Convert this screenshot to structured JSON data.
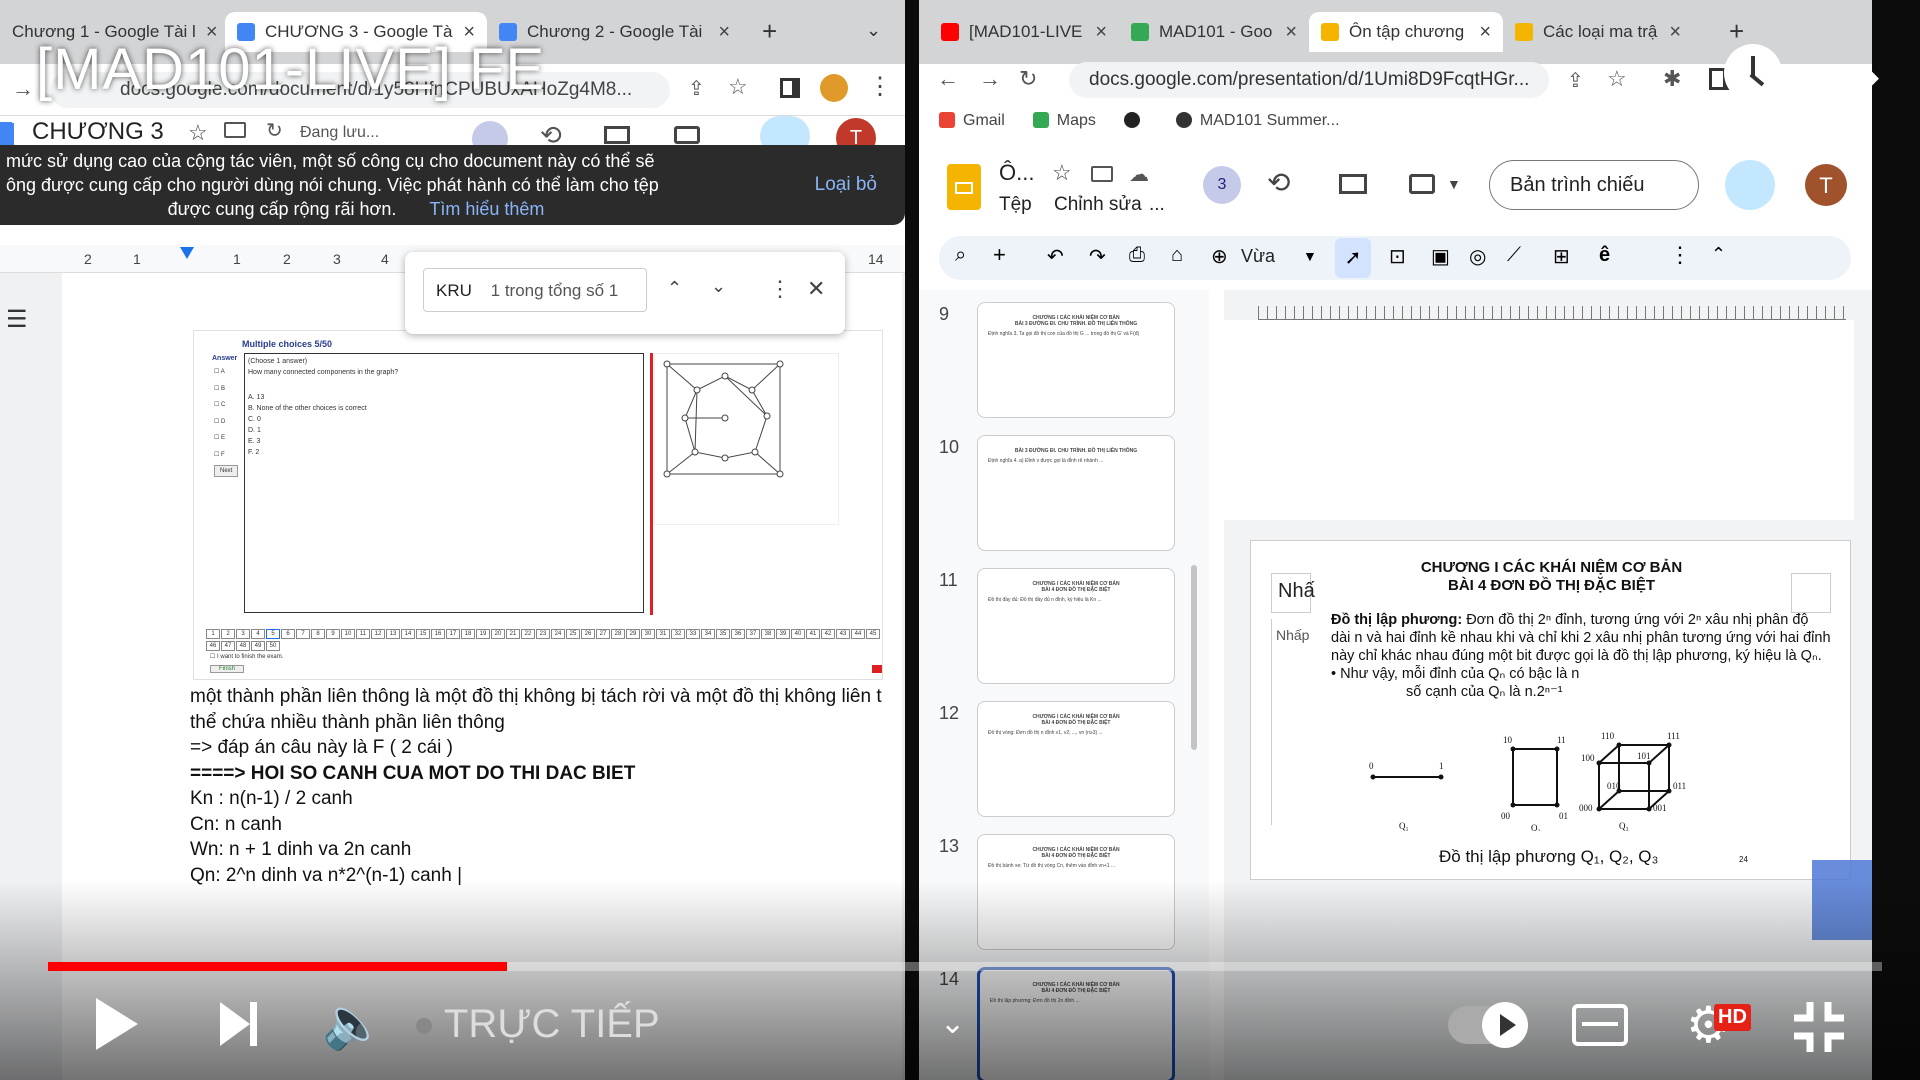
{
  "video": {
    "title": "[MAD101-LIVE] FE",
    "live_label": "TRỰC TIẾP",
    "progress_fraction": 0.25,
    "hd_badge": "HD"
  },
  "left": {
    "tabs": [
      {
        "label": "Chương 1 - Google Tài l",
        "color": "#4285f4"
      },
      {
        "label": "CHƯƠNG 3 - Google Tà",
        "color": "#4285f4"
      },
      {
        "label": "Chương 2 - Google Tài",
        "color": "#4285f4"
      }
    ],
    "url": "docs.google.com/document/d/1y58HfnCPUBUxAHoZg4M8...",
    "doc_title": "CHƯƠNG 3",
    "saving_status": "Đang lưu...",
    "notice": {
      "line1": "mức sử dụng cao của cộng tác viên, một số công cụ cho document này có thể sẽ",
      "line2": "ông được cung cấp cho người dùng nói chung. Việc phát hành có thể làm cho tệp",
      "line3": "được cung cấp rộng rãi hơn.",
      "learn_more": "Tìm hiểu thêm",
      "dismiss": "Loại bỏ"
    },
    "ruler": [
      "2",
      "1",
      "1",
      "2",
      "3",
      "4",
      "14"
    ],
    "find": {
      "query": "KRU",
      "count": "1 trong tổng số 1"
    },
    "quiz": {
      "header": "Multiple choices 5/50",
      "answer_label": "Answer",
      "choose": "(Choose 1 answer)",
      "question": "How many connected components in the graph?",
      "options": [
        "A. 13",
        "B. None of the other choices is correct",
        "C. 0",
        "D. 1",
        "E. 3",
        "F. 2"
      ],
      "letters": [
        "A",
        "B",
        "C",
        "D",
        "E",
        "F"
      ],
      "next": "Next",
      "finish_checkbox": "I want to finish the exam.",
      "finish_button": "Finish",
      "numbers": [
        "1",
        "2",
        "3",
        "4",
        "5",
        "6",
        "7",
        "8",
        "9",
        "10",
        "11",
        "12",
        "13",
        "14",
        "15",
        "16",
        "17",
        "18",
        "19",
        "20",
        "21",
        "22",
        "23",
        "24",
        "25",
        "26",
        "27",
        "28",
        "29",
        "30",
        "31",
        "32",
        "33",
        "34",
        "35",
        "36",
        "37",
        "38",
        "39",
        "40",
        "41",
        "42",
        "43",
        "44",
        "45",
        "46",
        "47",
        "48",
        "49",
        "50"
      ]
    },
    "notes": [
      {
        "text": "một thành phần liên thông là một đồ thị không bị tách rời và một đồ thị không liên t",
        "bold": false
      },
      {
        "text": "thể chứa nhiều thành phần liên thông",
        "bold": false
      },
      {
        "text": "=> đáp án câu này là F ( 2 cái )",
        "bold": false
      },
      {
        "text": "====> HOI SO CANH CUA MOT DO THI DAC BIET",
        "bold": true
      },
      {
        "text": "Kn : n(n-1) / 2 canh",
        "bold": false
      },
      {
        "text": "Cn: n canh",
        "bold": false
      },
      {
        "text": "Wn: n + 1 dinh va 2n canh",
        "bold": false
      },
      {
        "text": "Qn: 2^n dinh va n*2^(n-1) canh |",
        "bold": false
      }
    ]
  },
  "right": {
    "tabs": [
      {
        "label": "[MAD101-LIVE",
        "color": "#ff0000"
      },
      {
        "label": "MAD101 - Goo",
        "color": "#34a853"
      },
      {
        "label": "Ôn tập chương",
        "color": "#f4b400"
      },
      {
        "label": "Các loại ma trậ",
        "color": "#f4b400"
      }
    ],
    "url": "docs.google.com/presentation/d/1Umi8D9FcqtHGr...",
    "bookmarks": [
      {
        "label": "Gmail",
        "color": "#ea4335"
      },
      {
        "label": "Maps",
        "color": "#34a853"
      },
      {
        "label": "",
        "color": "#222222"
      },
      {
        "label": "MAD101 Summer...",
        "color": "#333333"
      }
    ],
    "slides_title": "Ô...",
    "menu": [
      "Tệp",
      "Chỉnh sửa",
      "..."
    ],
    "collaborators": "3",
    "present_label": "Bản trình chiếu",
    "user_initial": "T",
    "zoom": "Vừa",
    "thumbnails": [
      {
        "num": "9",
        "title": "CHƯƠNG I CÁC KHÁI NIỆM CƠ BẢN\nBÀI 3 ĐƯỜNG ĐI. CHU TRÌNH. ĐỒ THỊ LIÊN THÔNG",
        "body": "Định nghĩa 3. Ta gọi đồ thị con của đồ thị G ... trong đồ thị G' và F(đ)"
      },
      {
        "num": "10",
        "title": "BÀI 3 ĐƯỜNG ĐI. CHU TRÌNH. ĐỒ THỊ LIÊN THÔNG",
        "body": "Định nghĩa 4. a) Đỉnh v được gọi là đỉnh rẽ nhánh ..."
      },
      {
        "num": "11",
        "title": "CHƯƠNG I CÁC KHÁI NIỆM CƠ BẢN\nBÀI 4 ĐƠN ĐỒ THỊ ĐẶC BIỆT",
        "body": "Đồ thị đầy đủ: Đồ thị đầy đủ n đỉnh, ký hiệu là Kn ..."
      },
      {
        "num": "12",
        "title": "CHƯƠNG I CÁC KHÁI NIỆM CƠ BẢN\nBÀI 4 ĐƠN ĐỒ THỊ ĐẶC BIỆT",
        "body": "Đồ thị vòng: Đơn đồ thị n đỉnh v1, v2, ..., vn (n≥3) ..."
      },
      {
        "num": "13",
        "title": "CHƯƠNG I CÁC KHÁI NIỆM CƠ BẢN\nBÀI 4 ĐƠN ĐỒ THỊ ĐẶC BIỆT",
        "body": "Đồ thị bánh xe: Từ đồ thị vòng Cn, thêm vào đỉnh vn+1 ..."
      },
      {
        "num": "14",
        "title": "CHƯƠNG I CÁC KHÁI NIỆM CƠ BẢN\nBÀI 4 ĐƠN ĐỒ THỊ ĐẶC BIỆT",
        "body": "Đồ thị lập phương: Đơn đồ thị 2n đỉnh ..."
      }
    ],
    "slide": {
      "title_line1": "CHƯƠNG I CÁC KHÁI NIỆM CƠ BẢN",
      "title_line2": "BÀI 4 ĐƠN ĐỒ THỊ ĐẶC BIỆT",
      "placeholder_title": "Nhấ",
      "placeholder_body": "Nhấp",
      "def_label": "Đồ thị lập phương:",
      "def_text": "Đơn đồ thị 2ⁿ đỉnh, tương ứng với 2ⁿ xâu nhị phân độ dài n và hai đỉnh kề nhau khi và chỉ khi 2 xâu nhị phân tương ứng với hai đỉnh này chỉ khác nhau đúng một bit được gọi là đồ thị lập phương, ký hiệu là Qₙ.",
      "bullet1": "• Như vậy, mỗi đỉnh của Qₙ có bậc là n",
      "bullet2": "số cạnh của Qₙ là n.2ⁿ⁻¹",
      "caption": "Đồ thị lập phương Q₁, Q₂, Q₃",
      "page_no": "24",
      "q1_labels": [
        "0",
        "1",
        "Q₁"
      ],
      "q2_labels": [
        "10",
        "11",
        "00",
        "01",
        "Q₂"
      ],
      "q3_labels": [
        "110",
        "111",
        "100",
        "101",
        "010",
        "011",
        "000",
        "001",
        "Q₃"
      ]
    }
  },
  "colors": {
    "accent_blue": "#1a73e8",
    "yt_red": "#ff0000",
    "slides_yellow": "#f4b400",
    "avatar": "#a0522d"
  }
}
